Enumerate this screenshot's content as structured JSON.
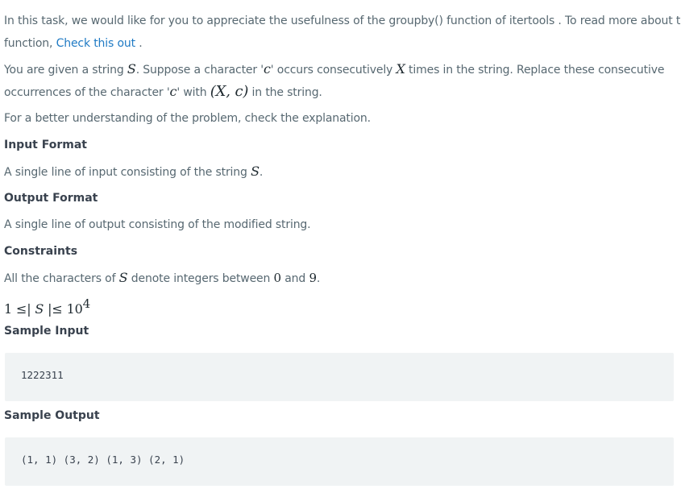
{
  "intro": {
    "text_before": "In this task, we would like for you to appreciate the usefulness of the groupby() function of itertools . To read more about this",
    "text_line2_before": "function, ",
    "link_label": "Check this out",
    "text_after": " ."
  },
  "statement": {
    "p1_a": "You are given a string ",
    "var_S": "S",
    "p1_b": ". Suppose a character '",
    "var_c": "c",
    "p1_c": "' occurs consecutively ",
    "var_X": "X",
    "p1_d": " times in the string. Replace these consecutive",
    "p2_a": "occurrences of the character '",
    "p2_b": "' with ",
    "tuple": "(X,  c)",
    "p2_c": "  in the string."
  },
  "explanation_hint": "For a better understanding of the problem, check the explanation.",
  "input_format": {
    "heading": "Input Format",
    "text_a": "A single line of input consisting of the string ",
    "text_b": "."
  },
  "output_format": {
    "heading": "Output Format",
    "text": "A single line of output consisting of the modified string."
  },
  "constraints": {
    "heading": "Constraints",
    "text_a": "All the characters of ",
    "text_b": " denote integers between ",
    "zero": "0",
    "text_c": " and ",
    "nine": "9",
    "text_d": ".",
    "bound_a": "1 ≤| ",
    "bound_b": " |≤ 10",
    "bound_exp": "4"
  },
  "sample_input": {
    "heading": "Sample Input",
    "code": "1222311"
  },
  "sample_output": {
    "heading": "Sample Output",
    "code": "(1, 1) (3, 2) (1, 3) (2, 1)"
  },
  "colors": {
    "body_text": "#576871",
    "heading_text": "#39424e",
    "link": "#1f7ac4",
    "code_background": "#f0f3f4"
  }
}
